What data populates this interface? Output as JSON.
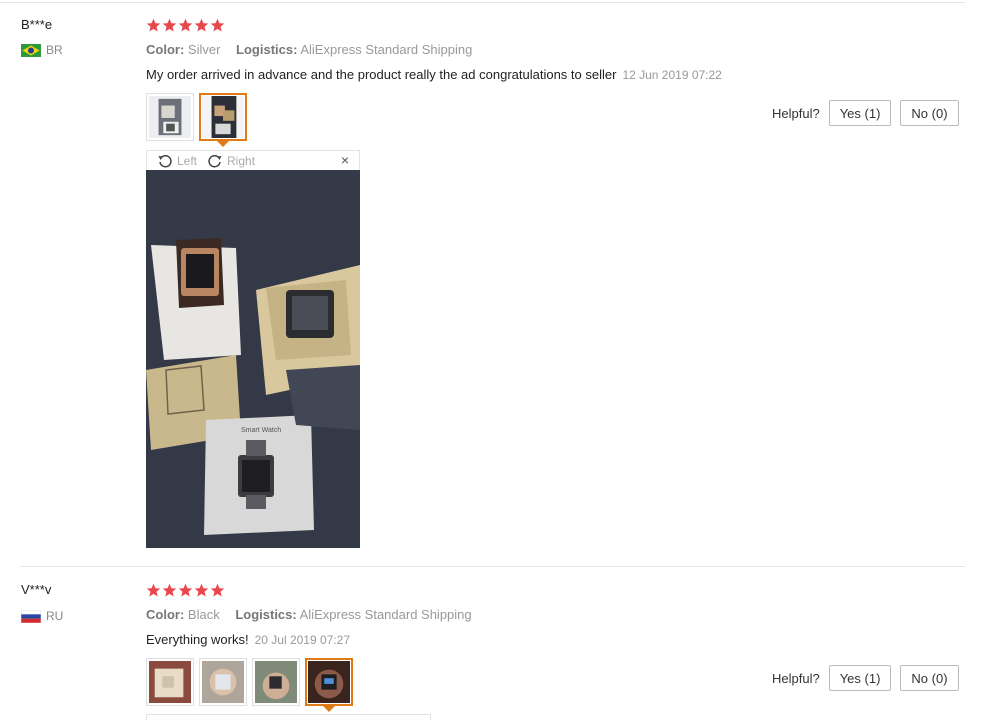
{
  "reviews": [
    {
      "user": "B***e",
      "country": "BR",
      "rating": 5,
      "color_label": "Color:",
      "color_value": "Silver",
      "logistics_label": "Logistics:",
      "logistics_value": "AliExpress Standard Shipping",
      "text": "My order arrived in advance and the product really the ad congratulations to seller",
      "date": "12 Jun 2019 07:22",
      "helpful_label": "Helpful?",
      "yes_label": "Yes (1)",
      "no_label": "No (0)",
      "viewer": {
        "left_label": "Left",
        "right_label": "Right",
        "close_label": "×"
      }
    },
    {
      "user": "V***v",
      "country": "RU",
      "rating": 5,
      "color_label": "Color:",
      "color_value": "Black",
      "logistics_label": "Logistics:",
      "logistics_value": "AliExpress Standard Shipping",
      "text": "Everything works!",
      "date": "20 Jul 2019 07:27",
      "helpful_label": "Helpful?",
      "yes_label": "Yes (1)",
      "no_label": "No (0)"
    }
  ],
  "colors": {
    "star": "#e8484b",
    "active_border": "#e07a16"
  }
}
